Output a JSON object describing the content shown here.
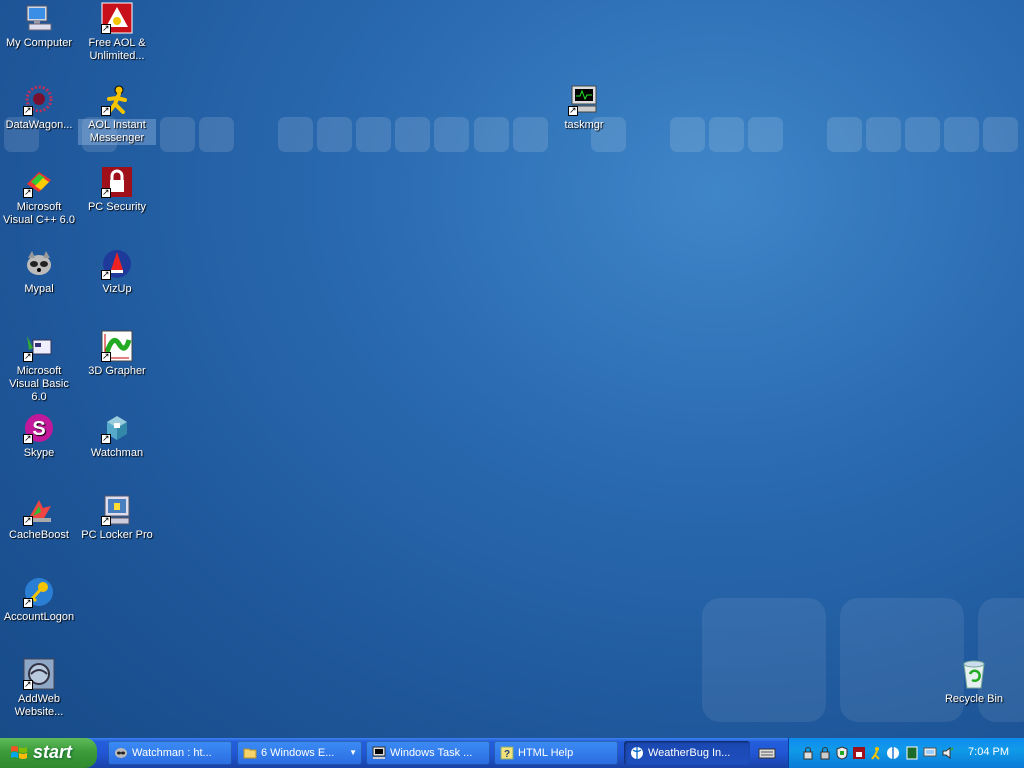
{
  "desktop": {
    "icons": [
      {
        "label": "My Computer",
        "icon": "my-computer-icon"
      },
      {
        "label": "Free AOL & Unlimited...",
        "icon": "aol-icon"
      },
      {
        "label": "DataWagon...",
        "icon": "datawagon-icon"
      },
      {
        "label": "AOL Instant Messenger",
        "icon": "aim-icon"
      },
      {
        "label": "Microsoft Visual C++ 6.0",
        "icon": "visual-cpp-icon"
      },
      {
        "label": "PC Security",
        "icon": "pc-security-icon"
      },
      {
        "label": "Mypal",
        "icon": "mypal-icon"
      },
      {
        "label": "VizUp",
        "icon": "vizup-icon"
      },
      {
        "label": "Microsoft Visual Basic 6.0",
        "icon": "visual-basic-icon"
      },
      {
        "label": "3D Grapher",
        "icon": "3d-grapher-icon"
      },
      {
        "label": "Skype",
        "icon": "skype-icon"
      },
      {
        "label": "Watchman",
        "icon": "watchman-icon"
      },
      {
        "label": "CacheBoost",
        "icon": "cacheboost-icon"
      },
      {
        "label": "PC Locker Pro",
        "icon": "pc-locker-icon"
      },
      {
        "label": "AccountLogon",
        "icon": "accountlogon-icon"
      },
      {
        "label": "AddWeb Website...",
        "icon": "addweb-icon"
      },
      {
        "label": "taskmgr",
        "icon": "taskmgr-icon"
      },
      {
        "label": "Recycle Bin",
        "icon": "recycle-bin-icon"
      }
    ]
  },
  "taskbar": {
    "start_label": "start",
    "buttons": [
      {
        "label": "Watchman : ht...",
        "icon": "watchman-icon"
      },
      {
        "label": "6 Windows E...",
        "icon": "folder-icon"
      },
      {
        "label": "Windows Task ...",
        "icon": "taskmgr-icon"
      },
      {
        "label": "HTML Help",
        "icon": "help-icon"
      },
      {
        "label": "WeatherBug In...",
        "icon": "weatherbug-icon"
      }
    ],
    "active_index": 4,
    "clock": "7:04 PM"
  },
  "colors": {
    "desktop": "#2a6ab0",
    "taskbar": "#245edb",
    "start": "#3c9c3a",
    "tray": "#109ae8"
  }
}
